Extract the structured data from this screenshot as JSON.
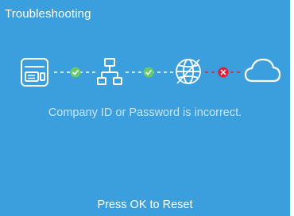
{
  "screen": {
    "title": "Troubleshooting",
    "message": "Company ID or Password is incorrect.",
    "footer": "Press OK to Reset"
  },
  "chain": {
    "nodes": [
      "device-icon",
      "network-icon",
      "globe-icon",
      "cloud-icon"
    ],
    "links": [
      {
        "status": "ok",
        "color": "#69c96b"
      },
      {
        "status": "ok",
        "color": "#69c96b"
      },
      {
        "status": "error",
        "color": "#e0203a"
      }
    ]
  }
}
